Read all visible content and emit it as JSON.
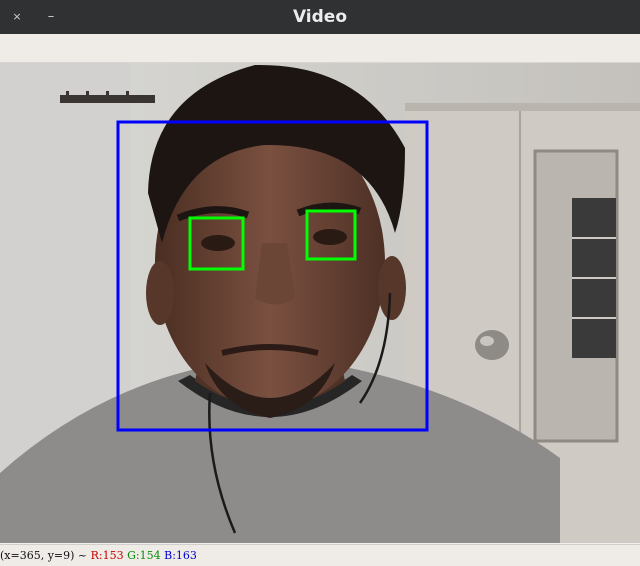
{
  "window": {
    "title": "Video",
    "close_glyph": "×",
    "minimize_glyph": "–"
  },
  "video": {
    "face_box_color": "#0000ff",
    "eye_box_color": "#00ff00",
    "detections": [
      "face",
      "left-eye",
      "right-eye"
    ]
  },
  "status": {
    "coords": "(x=365, y=9) ~ ",
    "r": "R:153",
    "g": "G:154",
    "b": "B:163"
  },
  "icons": {
    "close": "close-icon",
    "minimize": "minimize-icon"
  }
}
